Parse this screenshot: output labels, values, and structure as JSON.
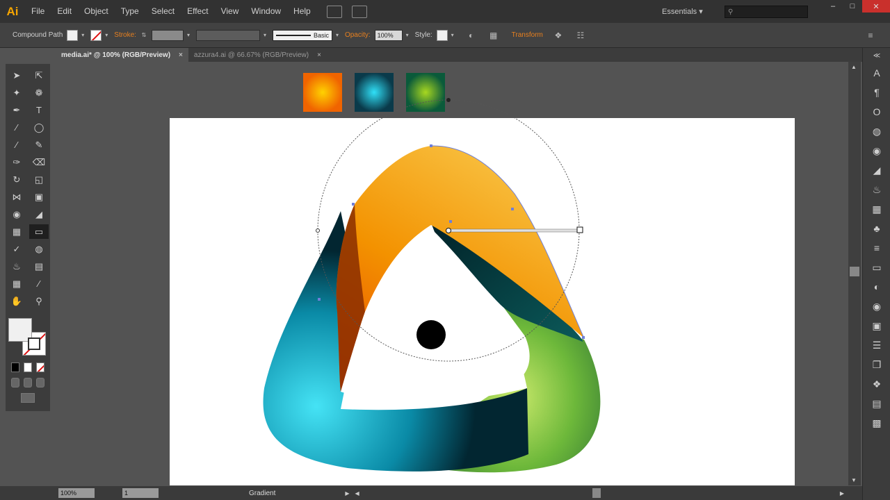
{
  "app": {
    "logo": "Ai"
  },
  "menu": [
    "File",
    "Edit",
    "Object",
    "Type",
    "Select",
    "Effect",
    "View",
    "Window",
    "Help"
  ],
  "workspace": {
    "label": "Essentials ▾"
  },
  "search": {
    "placeholder": ""
  },
  "control": {
    "selection": "Compound Path",
    "stroke_label": "Stroke:",
    "stroke_style": "Basic",
    "opacity_label": "Opacity:",
    "opacity_value": "100%",
    "style_label": "Style:",
    "transform_label": "Transform"
  },
  "tabs": [
    {
      "label": "media.ai* @ 100% (RGB/Preview)",
      "close": "×",
      "active": true
    },
    {
      "label": "azzura4.ai @ 66.67% (RGB/Preview)",
      "close": "×",
      "active": false
    }
  ],
  "status": {
    "zoom": "100%",
    "page": "1",
    "tool": "Gradient"
  },
  "colors": {
    "orange_swatch": "#f08a00",
    "cyan_swatch": "#10b8d8",
    "green_swatch": "#58b030",
    "accent": "#e8801f"
  }
}
